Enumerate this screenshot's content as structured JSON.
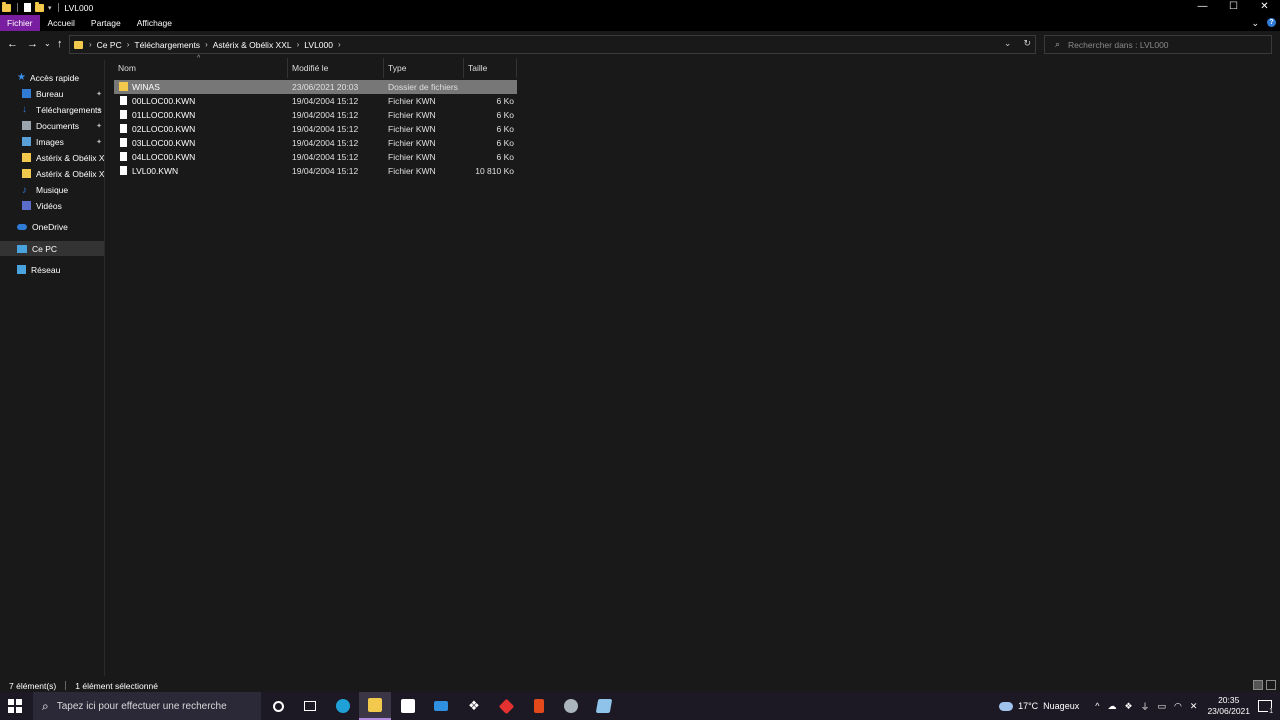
{
  "window": {
    "title": "LVL000",
    "controls": {
      "minimize": "—",
      "maximize": "☐",
      "close": "✕"
    }
  },
  "ribbon": {
    "tabs": [
      "Fichier",
      "Accueil",
      "Partage",
      "Affichage"
    ],
    "help_icon": "?"
  },
  "address": {
    "crumbs": [
      "Ce PC",
      "Téléchargements",
      "Astérix & Obélix XXL",
      "LVL000"
    ],
    "search_placeholder": "Rechercher dans : LVL000"
  },
  "sidebar": {
    "items": [
      {
        "label": "Accès rapide",
        "icon": "star-icon"
      },
      {
        "label": "Bureau",
        "icon": "desktop-icon",
        "pinned": true
      },
      {
        "label": "Téléchargements",
        "icon": "download-icon",
        "pinned": true
      },
      {
        "label": "Documents",
        "icon": "documents-icon",
        "pinned": true
      },
      {
        "label": "Images",
        "icon": "images-icon",
        "pinned": true
      },
      {
        "label": "Astérix & Obélix XX",
        "icon": "folder-icon"
      },
      {
        "label": "Astérix & Obélix XX",
        "icon": "folder-icon"
      },
      {
        "label": "Musique",
        "icon": "music-icon"
      },
      {
        "label": "Vidéos",
        "icon": "videos-icon"
      },
      {
        "label": "OneDrive",
        "icon": "cloud-icon"
      },
      {
        "label": "Ce PC",
        "icon": "computer-icon",
        "selected": true
      },
      {
        "label": "Réseau",
        "icon": "network-icon"
      }
    ]
  },
  "columns": {
    "name": "Nom",
    "modified": "Modifié le",
    "type": "Type",
    "size": "Taille"
  },
  "files": [
    {
      "name": "WINAS",
      "modified": "23/06/2021 20:03",
      "type": "Dossier de fichiers",
      "size": "",
      "kind": "folder",
      "selected": true
    },
    {
      "name": "00LLOC00.KWN",
      "modified": "19/04/2004 15:12",
      "type": "Fichier KWN",
      "size": "6 Ko",
      "kind": "file"
    },
    {
      "name": "01LLOC00.KWN",
      "modified": "19/04/2004 15:12",
      "type": "Fichier KWN",
      "size": "6 Ko",
      "kind": "file"
    },
    {
      "name": "02LLOC00.KWN",
      "modified": "19/04/2004 15:12",
      "type": "Fichier KWN",
      "size": "6 Ko",
      "kind": "file"
    },
    {
      "name": "03LLOC00.KWN",
      "modified": "19/04/2004 15:12",
      "type": "Fichier KWN",
      "size": "6 Ko",
      "kind": "file"
    },
    {
      "name": "04LLOC00.KWN",
      "modified": "19/04/2004 15:12",
      "type": "Fichier KWN",
      "size": "6 Ko",
      "kind": "file"
    },
    {
      "name": "LVL00.KWN",
      "modified": "19/04/2004 15:12",
      "type": "Fichier KWN",
      "size": "10 810 Ko",
      "kind": "file"
    }
  ],
  "status": {
    "count": "7 élément(s)",
    "selection": "1 élément sélectionné"
  },
  "taskbar": {
    "search_placeholder": "Tapez ici pour effectuer une recherche",
    "weather_temp": "17°C",
    "weather_text": "Nuageux",
    "time": "20:35",
    "date": "23/06/2021",
    "notification_count": "1"
  },
  "colors": {
    "accent": "#7a1ea1",
    "folder": "#f2c94c",
    "background": "#191919",
    "selection": "#777777"
  }
}
